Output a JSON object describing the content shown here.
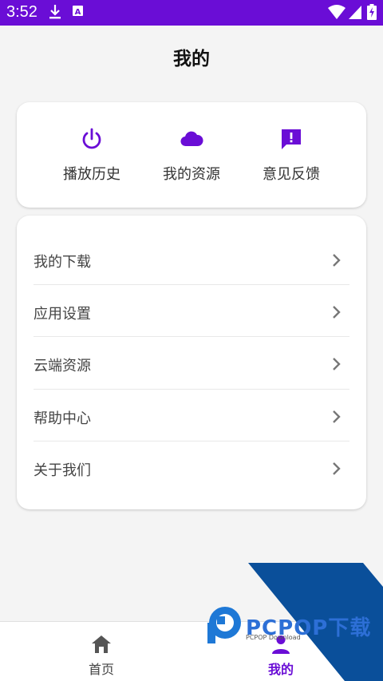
{
  "status_bar": {
    "time": "3:52",
    "bg_color": "#6a0dd6",
    "icons": [
      "download-icon",
      "a-icon",
      "wifi-icon",
      "signal-icon",
      "battery-charging-icon"
    ]
  },
  "header": {
    "title": "我的"
  },
  "quick_actions": [
    {
      "label": "播放历史",
      "icon": "power-icon"
    },
    {
      "label": "我的资源",
      "icon": "cloud-icon"
    },
    {
      "label": "意见反馈",
      "icon": "feedback-icon"
    }
  ],
  "menu": {
    "items": [
      {
        "label": "我的下载"
      },
      {
        "label": "应用设置"
      },
      {
        "label": "云端资源"
      },
      {
        "label": "帮助中心"
      },
      {
        "label": "关于我们"
      }
    ]
  },
  "bottom_nav": {
    "items": [
      {
        "label": "首页",
        "icon": "home-icon",
        "active": false
      },
      {
        "label": "我的",
        "icon": "person-icon",
        "active": true
      }
    ]
  },
  "watermark": {
    "brand": "PCPOP下载",
    "sub": "PCPOP Download"
  },
  "colors": {
    "accent": "#6a0dd6",
    "text_primary": "#111111",
    "watermark_blue": "#0a4f9a"
  }
}
